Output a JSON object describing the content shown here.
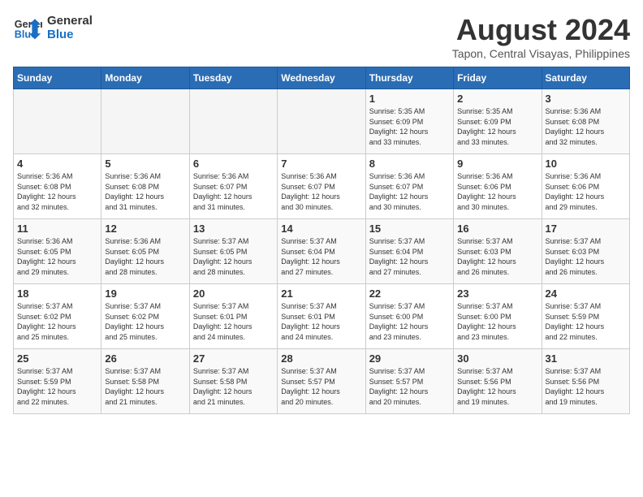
{
  "header": {
    "logo_general": "General",
    "logo_blue": "Blue",
    "month_year": "August 2024",
    "location": "Tapon, Central Visayas, Philippines"
  },
  "weekdays": [
    "Sunday",
    "Monday",
    "Tuesday",
    "Wednesday",
    "Thursday",
    "Friday",
    "Saturday"
  ],
  "weeks": [
    [
      {
        "day": "",
        "info": ""
      },
      {
        "day": "",
        "info": ""
      },
      {
        "day": "",
        "info": ""
      },
      {
        "day": "",
        "info": ""
      },
      {
        "day": "1",
        "info": "Sunrise: 5:35 AM\nSunset: 6:09 PM\nDaylight: 12 hours\nand 33 minutes."
      },
      {
        "day": "2",
        "info": "Sunrise: 5:35 AM\nSunset: 6:09 PM\nDaylight: 12 hours\nand 33 minutes."
      },
      {
        "day": "3",
        "info": "Sunrise: 5:36 AM\nSunset: 6:08 PM\nDaylight: 12 hours\nand 32 minutes."
      }
    ],
    [
      {
        "day": "4",
        "info": "Sunrise: 5:36 AM\nSunset: 6:08 PM\nDaylight: 12 hours\nand 32 minutes."
      },
      {
        "day": "5",
        "info": "Sunrise: 5:36 AM\nSunset: 6:08 PM\nDaylight: 12 hours\nand 31 minutes."
      },
      {
        "day": "6",
        "info": "Sunrise: 5:36 AM\nSunset: 6:07 PM\nDaylight: 12 hours\nand 31 minutes."
      },
      {
        "day": "7",
        "info": "Sunrise: 5:36 AM\nSunset: 6:07 PM\nDaylight: 12 hours\nand 30 minutes."
      },
      {
        "day": "8",
        "info": "Sunrise: 5:36 AM\nSunset: 6:07 PM\nDaylight: 12 hours\nand 30 minutes."
      },
      {
        "day": "9",
        "info": "Sunrise: 5:36 AM\nSunset: 6:06 PM\nDaylight: 12 hours\nand 30 minutes."
      },
      {
        "day": "10",
        "info": "Sunrise: 5:36 AM\nSunset: 6:06 PM\nDaylight: 12 hours\nand 29 minutes."
      }
    ],
    [
      {
        "day": "11",
        "info": "Sunrise: 5:36 AM\nSunset: 6:05 PM\nDaylight: 12 hours\nand 29 minutes."
      },
      {
        "day": "12",
        "info": "Sunrise: 5:36 AM\nSunset: 6:05 PM\nDaylight: 12 hours\nand 28 minutes."
      },
      {
        "day": "13",
        "info": "Sunrise: 5:37 AM\nSunset: 6:05 PM\nDaylight: 12 hours\nand 28 minutes."
      },
      {
        "day": "14",
        "info": "Sunrise: 5:37 AM\nSunset: 6:04 PM\nDaylight: 12 hours\nand 27 minutes."
      },
      {
        "day": "15",
        "info": "Sunrise: 5:37 AM\nSunset: 6:04 PM\nDaylight: 12 hours\nand 27 minutes."
      },
      {
        "day": "16",
        "info": "Sunrise: 5:37 AM\nSunset: 6:03 PM\nDaylight: 12 hours\nand 26 minutes."
      },
      {
        "day": "17",
        "info": "Sunrise: 5:37 AM\nSunset: 6:03 PM\nDaylight: 12 hours\nand 26 minutes."
      }
    ],
    [
      {
        "day": "18",
        "info": "Sunrise: 5:37 AM\nSunset: 6:02 PM\nDaylight: 12 hours\nand 25 minutes."
      },
      {
        "day": "19",
        "info": "Sunrise: 5:37 AM\nSunset: 6:02 PM\nDaylight: 12 hours\nand 25 minutes."
      },
      {
        "day": "20",
        "info": "Sunrise: 5:37 AM\nSunset: 6:01 PM\nDaylight: 12 hours\nand 24 minutes."
      },
      {
        "day": "21",
        "info": "Sunrise: 5:37 AM\nSunset: 6:01 PM\nDaylight: 12 hours\nand 24 minutes."
      },
      {
        "day": "22",
        "info": "Sunrise: 5:37 AM\nSunset: 6:00 PM\nDaylight: 12 hours\nand 23 minutes."
      },
      {
        "day": "23",
        "info": "Sunrise: 5:37 AM\nSunset: 6:00 PM\nDaylight: 12 hours\nand 23 minutes."
      },
      {
        "day": "24",
        "info": "Sunrise: 5:37 AM\nSunset: 5:59 PM\nDaylight: 12 hours\nand 22 minutes."
      }
    ],
    [
      {
        "day": "25",
        "info": "Sunrise: 5:37 AM\nSunset: 5:59 PM\nDaylight: 12 hours\nand 22 minutes."
      },
      {
        "day": "26",
        "info": "Sunrise: 5:37 AM\nSunset: 5:58 PM\nDaylight: 12 hours\nand 21 minutes."
      },
      {
        "day": "27",
        "info": "Sunrise: 5:37 AM\nSunset: 5:58 PM\nDaylight: 12 hours\nand 21 minutes."
      },
      {
        "day": "28",
        "info": "Sunrise: 5:37 AM\nSunset: 5:57 PM\nDaylight: 12 hours\nand 20 minutes."
      },
      {
        "day": "29",
        "info": "Sunrise: 5:37 AM\nSunset: 5:57 PM\nDaylight: 12 hours\nand 20 minutes."
      },
      {
        "day": "30",
        "info": "Sunrise: 5:37 AM\nSunset: 5:56 PM\nDaylight: 12 hours\nand 19 minutes."
      },
      {
        "day": "31",
        "info": "Sunrise: 5:37 AM\nSunset: 5:56 PM\nDaylight: 12 hours\nand 19 minutes."
      }
    ]
  ]
}
